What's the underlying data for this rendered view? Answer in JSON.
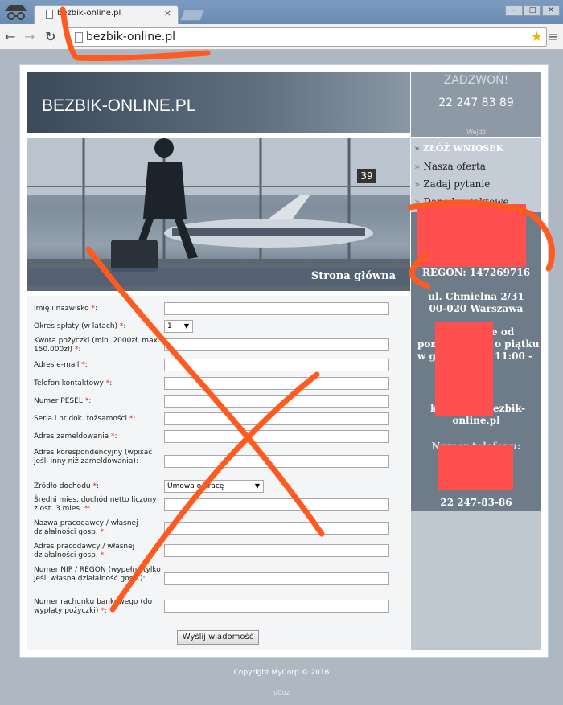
{
  "browser": {
    "tab_title": "bezbik-online.pl",
    "tab_close": "×",
    "url": "bezbik-online.pl",
    "back": "←",
    "forward": "→",
    "reload": "↻",
    "star": "★",
    "menu": "≡"
  },
  "header": {
    "site_title": "BEZBIK-ONLINE.PL"
  },
  "hero": {
    "caption": "Strona główna",
    "gate_number": "39"
  },
  "call": {
    "label": "ZADZWOŃ!",
    "phone": "22 247 83 89",
    "more": "Wejdź"
  },
  "nav": {
    "bullet": "»",
    "items": [
      {
        "label": "ZŁÓŻ WNIOSEK",
        "active": true
      },
      {
        "label": "Nasza oferta",
        "active": false
      },
      {
        "label": "Zadaj pytanie",
        "active": false
      },
      {
        "label": "Dane kontaktowe",
        "active": false
      }
    ]
  },
  "info": {
    "regon": "REGON: 147269716",
    "address_line1": "ul. Chmielna 2/31",
    "address_line2": "00-020 Warszawa",
    "hours_line1": "e od",
    "hours_line2": "poni",
    "hours_line3": "o piątku",
    "hours_line4": "11:00 -",
    "hours_line5": "w g",
    "email_part1": "k",
    "email_part2": "ezbik-",
    "email_line2": "online.pl",
    "phone_label": "Numer telefonu:",
    "phone_number": "22 247-83-86"
  },
  "form": {
    "required_mark": "*",
    "fields": [
      {
        "label": "Imię i nazwisko",
        "required": true
      },
      {
        "label": "Okres spłaty (w latach)",
        "required": true,
        "select_value": "1"
      },
      {
        "label": "Kwota pożyczki (min. 2000zł, max. 150.000zł)",
        "required": true
      },
      {
        "label": "Adres e-mail",
        "required": true
      },
      {
        "label": "Telefon kontaktowy",
        "required": true
      },
      {
        "label": "Numer PESEL",
        "required": true
      },
      {
        "label": "Seria i nr dok. tożsamości",
        "required": true
      },
      {
        "label": "Adres zameldowania",
        "required": true
      },
      {
        "label": "Adres korespondencyjny (wpisać jeśli inny niż zameldowania):",
        "required": false
      },
      {
        "label": "Źródło dochodu",
        "required": true,
        "select_value": "Umowa o pracę"
      },
      {
        "label": "Średni mies. dochód netto liczony z ost. 3 mies.",
        "required": true
      },
      {
        "label": "Nazwa pracodawcy / własnej działalności gosp.",
        "required": true
      },
      {
        "label": "Adres pracodawcy / własnej działalności gosp.",
        "required": true
      },
      {
        "label": "Numer NIP / REGON (wypełnij tylko jeśli własna działalność gosp.):",
        "required": false
      },
      {
        "label": "Numer rachunku bankowego (do wypłaty pożyczki)",
        "required": true
      }
    ],
    "submit_label": "Wyślij wiadomość"
  },
  "footer": {
    "copyright": "Copyright MyCorp © 2016",
    "ucoz": "uCoz"
  },
  "colors": {
    "annotation": "#ff5a1f",
    "redaction": "#ff4f4f",
    "sidebar_dark": "#6e7b88"
  }
}
